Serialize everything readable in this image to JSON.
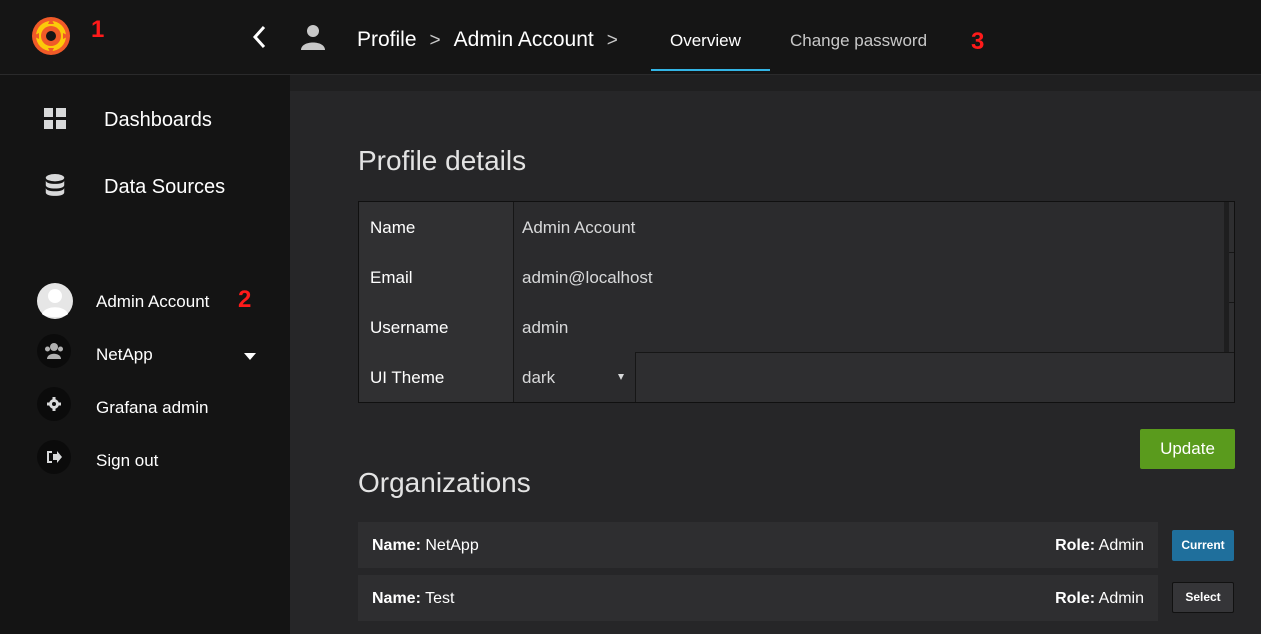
{
  "header": {
    "breadcrumb": [
      "Profile",
      "Admin Account"
    ],
    "separator": ">",
    "tabs": [
      {
        "label": "Overview",
        "active": true
      },
      {
        "label": "Change password",
        "active": false
      }
    ]
  },
  "annotations": [
    "1",
    "2",
    "3"
  ],
  "sidebar": {
    "nav": [
      {
        "label": "Dashboards",
        "icon": "grid-icon"
      },
      {
        "label": "Data Sources",
        "icon": "database-icon"
      }
    ],
    "user": [
      {
        "label": "Admin Account",
        "icon": "avatar-icon"
      },
      {
        "label": "NetApp",
        "icon": "users-icon"
      },
      {
        "label": "Grafana admin",
        "icon": "gear-icon"
      },
      {
        "label": "Sign out",
        "icon": "sign-out-icon"
      }
    ]
  },
  "profile": {
    "title": "Profile details",
    "fields": [
      {
        "label": "Name",
        "value": "Admin Account"
      },
      {
        "label": "Email",
        "value": "admin@localhost"
      },
      {
        "label": "Username",
        "value": "admin"
      }
    ],
    "theme": {
      "label": "UI Theme",
      "value": "dark"
    },
    "update_label": "Update"
  },
  "organizations": {
    "title": "Organizations",
    "name_prefix": "Name:",
    "role_prefix": "Role:",
    "rows": [
      {
        "name": "NetApp",
        "role": "Admin",
        "action": "Current"
      },
      {
        "name": "Test",
        "role": "Admin",
        "action": "Select"
      }
    ]
  },
  "colors": {
    "accent_tab": "#33b5e5",
    "update_button": "#5a9b1d",
    "current_button": "#1f6f9c",
    "annotation": "#ff1a1a"
  }
}
